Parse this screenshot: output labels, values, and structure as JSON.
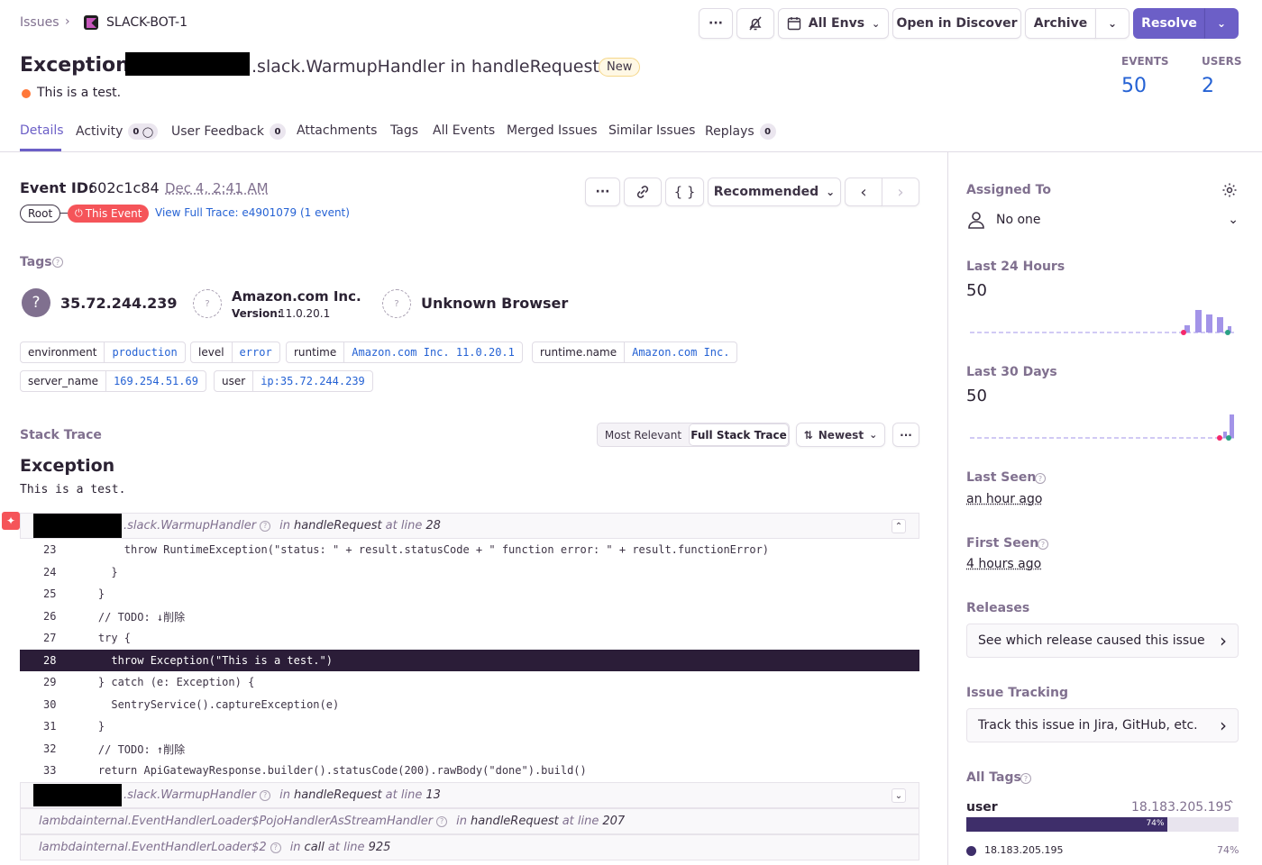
{
  "breadcrumb": {
    "issues": "Issues",
    "project": "SLACK-BOT-1"
  },
  "toolbar": {
    "more": "···",
    "envs": "All Envs",
    "discover": "Open in Discover",
    "archive": "Archive",
    "resolve": "Resolve"
  },
  "header": {
    "title_prefix": "Exception",
    "title_suffix": ".slack.WarmupHandler in handleRequest",
    "new_badge": "New",
    "message": "This is a test.",
    "events_label": "EVENTS",
    "events_value": "50",
    "users_label": "USERS",
    "users_value": "2"
  },
  "tabs": [
    {
      "label": "Details"
    },
    {
      "label": "Activity",
      "count": "0"
    },
    {
      "label": "User Feedback",
      "count": "0"
    },
    {
      "label": "Attachments"
    },
    {
      "label": "Tags"
    },
    {
      "label": "All Events"
    },
    {
      "label": "Merged Issues"
    },
    {
      "label": "Similar Issues"
    },
    {
      "label": "Replays",
      "count": "0"
    }
  ],
  "event": {
    "id_label": "Event ID:",
    "id": "602c1c84",
    "date": "Dec 4, 2:41 AM",
    "root": "Root",
    "this_event": "This Event",
    "full_trace": "View Full Trace: e4901079 (1 event)",
    "recommended": "Recommended"
  },
  "tags": {
    "title": "Tags",
    "ip": "35.72.244.239",
    "os_name": "Amazon.com Inc.",
    "os_version_label": "Version:",
    "os_version": "11.0.20.1",
    "browser": "Unknown Browser",
    "pills": [
      {
        "k": "environment",
        "v": "production"
      },
      {
        "k": "level",
        "v": "error"
      },
      {
        "k": "runtime",
        "v": "Amazon.com Inc. 11.0.20.1"
      },
      {
        "k": "runtime.name",
        "v": "Amazon.com Inc."
      },
      {
        "k": "server_name",
        "v": "169.254.51.69"
      },
      {
        "k": "user",
        "v": "ip:35.72.244.239"
      }
    ]
  },
  "stack": {
    "title": "Stack Trace",
    "most_relevant": "Most Relevant",
    "full_stack": "Full Stack Trace",
    "newest": "Newest",
    "exception": "Exception",
    "message": "This is a test.",
    "frame1": {
      "module": ".slack.WarmupHandler",
      "in": "in",
      "fn": "handleRequest",
      "at": "at line",
      "line": "28"
    },
    "frame2": {
      "module": ".slack.WarmupHandler",
      "in": "in",
      "fn": "handleRequest",
      "at": "at line",
      "line": "13"
    },
    "frame3": {
      "module": "lambdainternal.EventHandlerLoader$PojoHandlerAsStreamHandler",
      "in": "in",
      "fn": "handleRequest",
      "at": "at line",
      "line": "207"
    },
    "frame4": {
      "module": "lambdainternal.EventHandlerLoader$2",
      "in": "in",
      "fn": "call",
      "at": "at line",
      "line": "925"
    },
    "code": [
      {
        "n": "23",
        "t": "        throw RuntimeException(\"status: \" + result.statusCode + \" function error: \" + result.functionError)"
      },
      {
        "n": "24",
        "t": "      }"
      },
      {
        "n": "25",
        "t": "    }"
      },
      {
        "n": "26",
        "t": "    // TODO: ↓削除"
      },
      {
        "n": "27",
        "t": "    try {"
      },
      {
        "n": "28",
        "t": "      throw Exception(\"This is a test.\")"
      },
      {
        "n": "29",
        "t": "    } catch (e: Exception) {"
      },
      {
        "n": "30",
        "t": "      SentryService().captureException(e)"
      },
      {
        "n": "31",
        "t": "    }"
      },
      {
        "n": "32",
        "t": "    // TODO: ↑削除"
      },
      {
        "n": "33",
        "t": "    return ApiGatewayResponse.builder().statusCode(200).rawBody(\"done\").build()"
      }
    ]
  },
  "sidebar": {
    "assigned_label": "Assigned To",
    "assigned_value": "No one",
    "last24_label": "Last 24 Hours",
    "last24_value": "50",
    "last30_label": "Last 30 Days",
    "last30_value": "50",
    "last_seen_label": "Last Seen",
    "last_seen_value": "an hour ago",
    "first_seen_label": "First Seen",
    "first_seen_value": "4 hours ago",
    "releases_label": "Releases",
    "releases_link": "See which release caused this issue",
    "tracking_label": "Issue Tracking",
    "tracking_link": "Track this issue in Jira, GitHub, etc.",
    "all_tags_label": "All Tags",
    "user_tag_key": "user",
    "user_tag_top": "18.183.205.195",
    "user_tag_pct": "74%",
    "user_tag_fraction": 0.74,
    "user_tag_item": "18.183.205.195",
    "user_tag_item_pct": "74%"
  },
  "colors": {
    "accent": "#6c5fc7",
    "link": "#2562d4",
    "error": "#f55459",
    "sparkbar": "#a394e8"
  }
}
